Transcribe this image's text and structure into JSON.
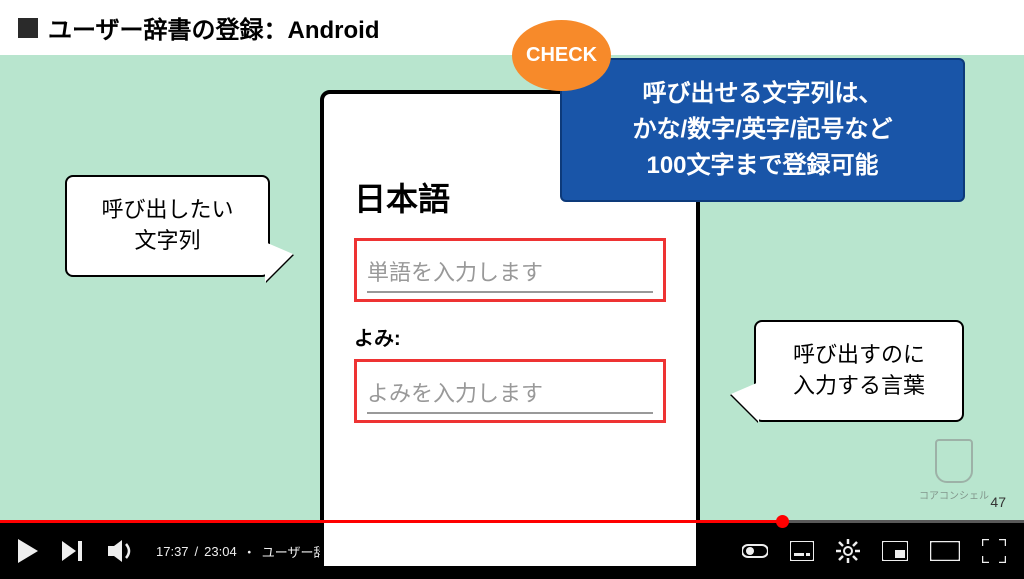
{
  "title": "ユーザー辞書の登録：Android",
  "check_badge": "CHECK",
  "info_box": {
    "line1": "呼び出せる文字列は、",
    "line2": "かな/数字/英字/記号など",
    "line3": "100文字まで登録可能"
  },
  "phone": {
    "heading": "日本語",
    "input1_placeholder": "単語を入力します",
    "field2_label": "よみ:",
    "input2_placeholder": "よみを入力します"
  },
  "callout_left": {
    "line1": "呼び出したい",
    "line2": "文字列"
  },
  "callout_right": {
    "line1": "呼び出すのに",
    "line2": "入力する言葉"
  },
  "brand": "コアコンシェル",
  "page_number": "47",
  "player": {
    "current_time": "17:37",
    "duration": "23:04",
    "separator": " / ",
    "chapter_prefix": "・",
    "chapter": "ユーザー辞書登録：Android"
  }
}
